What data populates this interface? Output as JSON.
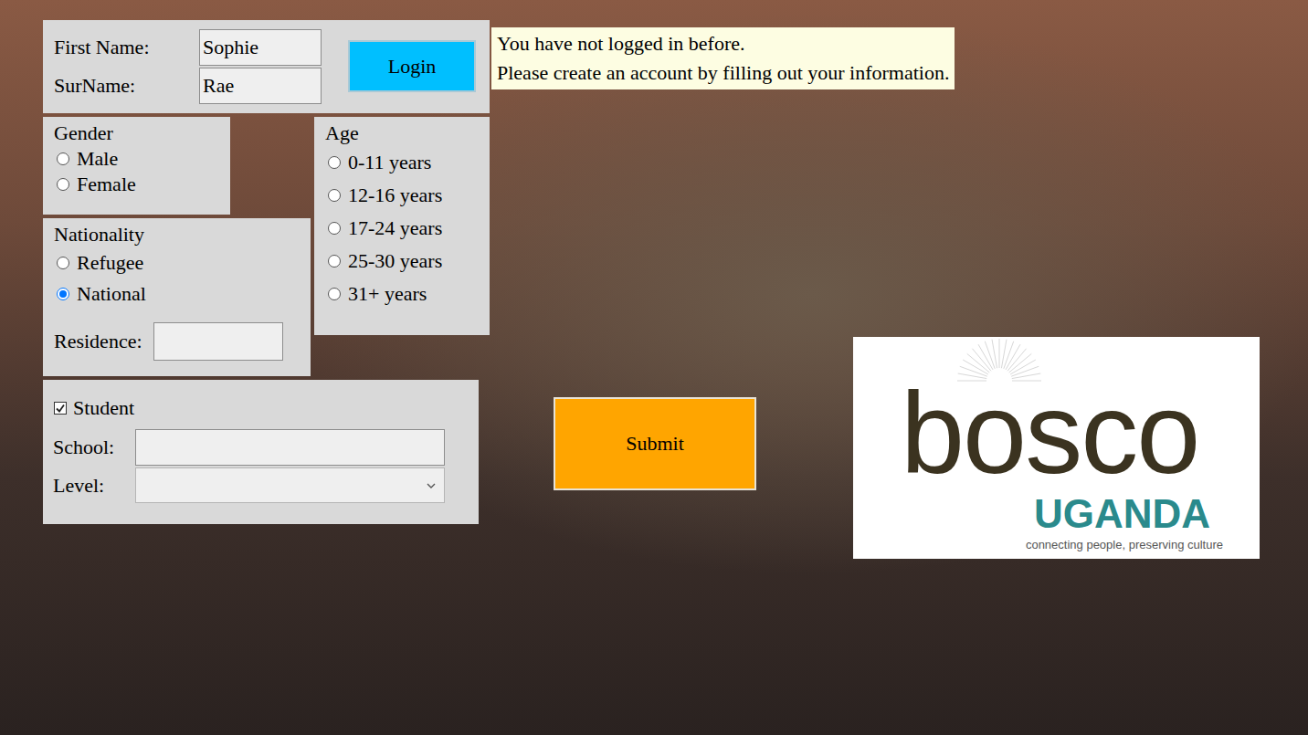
{
  "login_form": {
    "fields": [
      {
        "label": "First Name:",
        "value": "Sophie"
      },
      {
        "label": "SurName:",
        "value": "Rae"
      }
    ],
    "button": "Login"
  },
  "message": [
    "You have not logged in before.",
    "Please create an account by filling out your information."
  ],
  "gender": {
    "title": "Gender",
    "options": [
      {
        "label": "Male",
        "selected": false
      },
      {
        "label": "Female",
        "selected": false
      }
    ]
  },
  "age": {
    "title": "Age",
    "options": [
      {
        "label": "0-11 years",
        "selected": false
      },
      {
        "label": "12-16 years",
        "selected": false
      },
      {
        "label": "17-24 years",
        "selected": false
      },
      {
        "label": "25-30 years",
        "selected": false
      },
      {
        "label": "31+ years",
        "selected": false
      }
    ]
  },
  "nationality": {
    "title": "Nationality",
    "options": [
      {
        "label": "Refugee",
        "selected": false
      },
      {
        "label": "National",
        "selected": true
      }
    ],
    "residence": {
      "label": "Residence:",
      "value": ""
    }
  },
  "student": {
    "label": "Student",
    "checked": true,
    "school": {
      "label": "School:",
      "value": ""
    },
    "level": {
      "label": "Level:",
      "value": ""
    }
  },
  "submit": "Submit",
  "logo": {
    "name": "bosco",
    "country": "UGANDA",
    "tagline": "connecting people, preserving culture"
  }
}
